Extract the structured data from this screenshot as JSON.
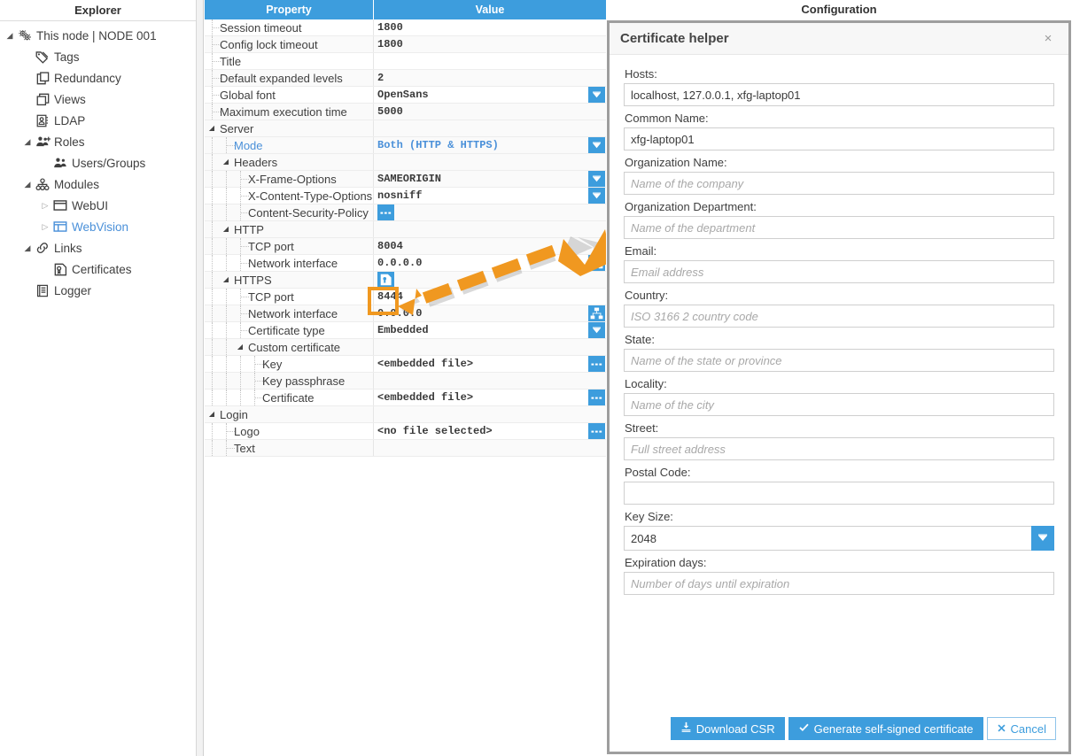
{
  "explorer": {
    "header": "Explorer",
    "items": [
      {
        "label": "This node | NODE 001",
        "icon": "gears-icon",
        "twisty": "expanded",
        "depth": 0,
        "accent": false
      },
      {
        "label": "Tags",
        "icon": "tag-icon",
        "twisty": "none",
        "depth": 1,
        "accent": false
      },
      {
        "label": "Redundancy",
        "icon": "redundancy-icon",
        "twisty": "none",
        "depth": 1,
        "accent": false
      },
      {
        "label": "Views",
        "icon": "views-icon",
        "twisty": "none",
        "depth": 1,
        "accent": false
      },
      {
        "label": "LDAP",
        "icon": "ldap-icon",
        "twisty": "none",
        "depth": 1,
        "accent": false
      },
      {
        "label": "Roles",
        "icon": "roles-icon",
        "twisty": "expanded",
        "depth": 1,
        "accent": false
      },
      {
        "label": "Users/Groups",
        "icon": "users-icon",
        "twisty": "none",
        "depth": 2,
        "accent": false
      },
      {
        "label": "Modules",
        "icon": "modules-icon",
        "twisty": "expanded",
        "depth": 1,
        "accent": false
      },
      {
        "label": "WebUI",
        "icon": "webui-icon",
        "twisty": "collapsed",
        "depth": 2,
        "accent": false
      },
      {
        "label": "WebVision",
        "icon": "webvision-icon",
        "twisty": "collapsed",
        "depth": 2,
        "accent": true
      },
      {
        "label": "Links",
        "icon": "link-icon",
        "twisty": "expanded",
        "depth": 1,
        "accent": false
      },
      {
        "label": "Certificates",
        "icon": "certificate-icon",
        "twisty": "none",
        "depth": 2,
        "accent": false
      },
      {
        "label": "Logger",
        "icon": "logger-icon",
        "twisty": "none",
        "depth": 1,
        "accent": false
      }
    ]
  },
  "grid": {
    "columns": {
      "property": "Property",
      "value": "Value"
    },
    "rows": [
      {
        "label": "Session timeout",
        "value": "1800",
        "depth": 0,
        "twisty": "none",
        "accent": false,
        "button": "none"
      },
      {
        "label": "Config lock timeout",
        "value": "1800",
        "depth": 0,
        "twisty": "none",
        "accent": false,
        "button": "none"
      },
      {
        "label": "Title",
        "value": "",
        "depth": 0,
        "twisty": "none",
        "accent": false,
        "button": "none"
      },
      {
        "label": "Default expanded levels",
        "value": "2",
        "depth": 0,
        "twisty": "none",
        "accent": false,
        "button": "none"
      },
      {
        "label": "Global font",
        "value": "OpenSans",
        "depth": 0,
        "twisty": "none",
        "accent": false,
        "button": "dropdown"
      },
      {
        "label": "Maximum execution time",
        "value": "5000",
        "depth": 0,
        "twisty": "none",
        "accent": false,
        "button": "none"
      },
      {
        "label": "Server",
        "value": "",
        "depth": 0,
        "twisty": "expanded",
        "accent": false,
        "button": "none"
      },
      {
        "label": "Mode",
        "value": "Both  (HTTP & HTTPS)",
        "depth": 1,
        "twisty": "none",
        "accent": true,
        "button": "dropdown"
      },
      {
        "label": "Headers",
        "value": "",
        "depth": 1,
        "twisty": "expanded",
        "accent": false,
        "button": "none"
      },
      {
        "label": "X-Frame-Options",
        "value": "SAMEORIGIN",
        "depth": 2,
        "twisty": "none",
        "accent": false,
        "button": "dropdown"
      },
      {
        "label": "X-Content-Type-Options",
        "value": "nosniff",
        "depth": 2,
        "twisty": "none",
        "accent": false,
        "button": "dropdown"
      },
      {
        "label": "Content-Security-Policy",
        "value": "",
        "depth": 2,
        "twisty": "none",
        "accent": false,
        "button": "ellipsis-inline"
      },
      {
        "label": "HTTP",
        "value": "",
        "depth": 1,
        "twisty": "expanded",
        "accent": false,
        "button": "none"
      },
      {
        "label": "TCP port",
        "value": "8004",
        "depth": 2,
        "twisty": "none",
        "accent": false,
        "button": "none"
      },
      {
        "label": "Network interface",
        "value": "0.0.0.0",
        "depth": 2,
        "twisty": "none",
        "accent": false,
        "button": "network"
      },
      {
        "label": "HTTPS",
        "value": "",
        "depth": 1,
        "twisty": "expanded",
        "accent": false,
        "button": "cert-helper-inline"
      },
      {
        "label": "TCP port",
        "value": "8444",
        "depth": 2,
        "twisty": "none",
        "accent": false,
        "button": "none"
      },
      {
        "label": "Network interface",
        "value": "0.0.0.0",
        "depth": 2,
        "twisty": "none",
        "accent": false,
        "button": "network"
      },
      {
        "label": "Certificate type",
        "value": "Embedded",
        "depth": 2,
        "twisty": "none",
        "accent": false,
        "button": "dropdown"
      },
      {
        "label": "Custom certificate",
        "value": "",
        "depth": 2,
        "twisty": "expanded",
        "accent": false,
        "button": "none"
      },
      {
        "label": "Key",
        "value": "<embedded file>",
        "depth": 3,
        "twisty": "none",
        "accent": false,
        "button": "ellipsis"
      },
      {
        "label": "Key passphrase",
        "value": "",
        "depth": 3,
        "twisty": "none",
        "accent": false,
        "button": "none"
      },
      {
        "label": "Certificate",
        "value": "<embedded file>",
        "depth": 3,
        "twisty": "none",
        "accent": false,
        "button": "ellipsis"
      },
      {
        "label": "Login",
        "value": "",
        "depth": 0,
        "twisty": "expanded",
        "accent": false,
        "button": "none"
      },
      {
        "label": "Logo",
        "value": "<no file selected>",
        "depth": 1,
        "twisty": "none",
        "accent": false,
        "button": "ellipsis"
      },
      {
        "label": "Text",
        "value": "",
        "depth": 1,
        "twisty": "none",
        "accent": false,
        "button": "none"
      }
    ]
  },
  "config": {
    "title": "Configuration"
  },
  "dialog": {
    "title": "Certificate helper",
    "close_label": "×",
    "fields": [
      {
        "label": "Hosts:",
        "value": "localhost, 127.0.0.1, xfg-laptop01",
        "placeholder": "",
        "type": "text"
      },
      {
        "label": "Common Name:",
        "value": "xfg-laptop01",
        "placeholder": "",
        "type": "text"
      },
      {
        "label": "Organization Name:",
        "value": "",
        "placeholder": "Name of the company",
        "type": "text"
      },
      {
        "label": "Organization Department:",
        "value": "",
        "placeholder": "Name of the department",
        "type": "text"
      },
      {
        "label": "Email:",
        "value": "",
        "placeholder": "Email address",
        "type": "text"
      },
      {
        "label": "Country:",
        "value": "",
        "placeholder": "ISO 3166 2 country code",
        "type": "text"
      },
      {
        "label": "State:",
        "value": "",
        "placeholder": "Name of the state or province",
        "type": "text"
      },
      {
        "label": "Locality:",
        "value": "",
        "placeholder": "Name of the city",
        "type": "text"
      },
      {
        "label": "Street:",
        "value": "",
        "placeholder": "Full street address",
        "type": "text"
      },
      {
        "label": "Postal Code:",
        "value": "",
        "placeholder": "",
        "type": "text"
      },
      {
        "label": "Key Size:",
        "value": "2048",
        "placeholder": "",
        "type": "select"
      },
      {
        "label": "Expiration days:",
        "value": "",
        "placeholder": "Number of days until expiration",
        "type": "text"
      }
    ],
    "buttons": {
      "download_csr": "Download CSR",
      "generate": "Generate self-signed certificate",
      "cancel": "Cancel"
    }
  },
  "colors": {
    "accent_blue": "#3d9ddd",
    "annotation_orange": "#f09820",
    "link_blue": "#4a90d9",
    "dialog_border": "#9e9e9e"
  }
}
